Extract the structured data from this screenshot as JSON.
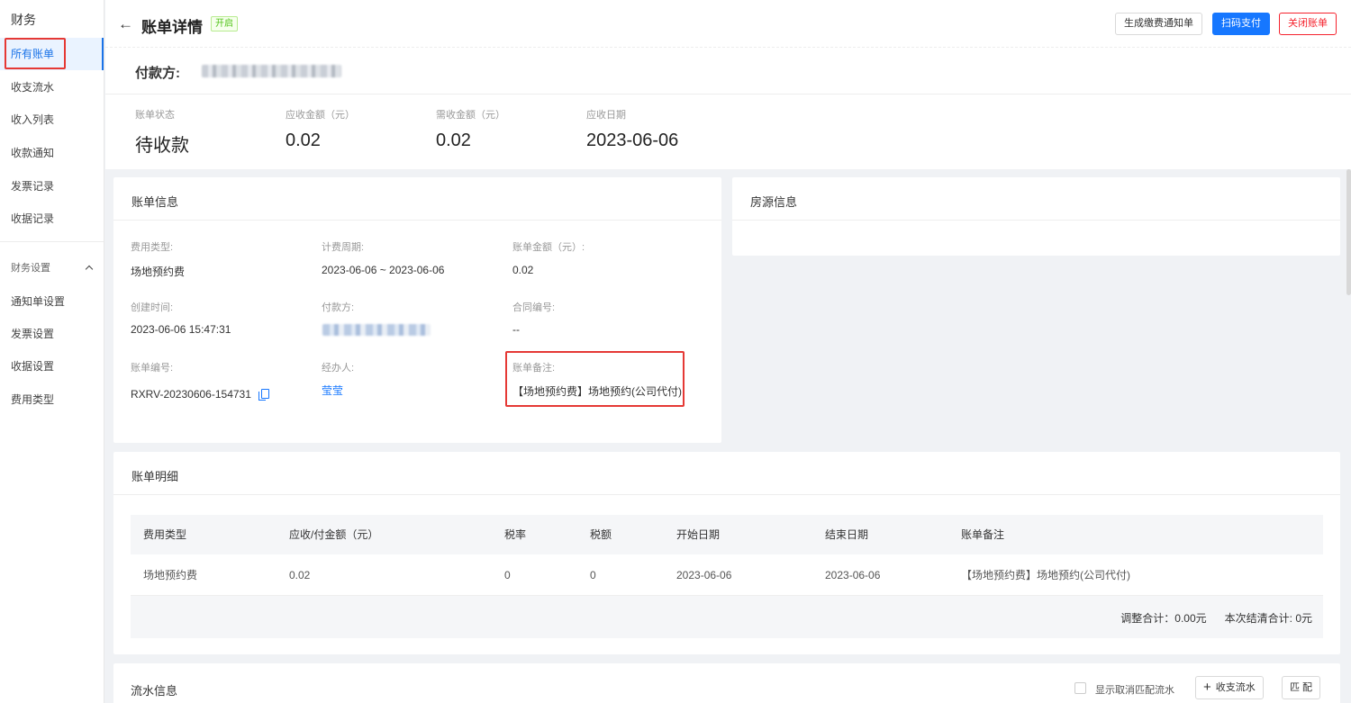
{
  "sidebar": {
    "title": "财务",
    "items": [
      {
        "label": "所有账单"
      },
      {
        "label": "收支流水"
      },
      {
        "label": "收入列表"
      },
      {
        "label": "收款通知"
      },
      {
        "label": "发票记录"
      },
      {
        "label": "收据记录"
      }
    ],
    "group_label": "财务设置",
    "sub_items": [
      {
        "label": "通知单设置"
      },
      {
        "label": "发票设置"
      },
      {
        "label": "收据设置"
      },
      {
        "label": "费用类型"
      }
    ]
  },
  "header": {
    "back_icon": "arrow-left",
    "title": "账单详情",
    "badge": "开启",
    "buttons": {
      "notice": "生成缴费通知单",
      "scan_pay": "扫码支付",
      "close_bill": "关闭账单"
    },
    "payer_label": "付款方:"
  },
  "summary": [
    {
      "label": "账单状态",
      "value": "待收款"
    },
    {
      "label": "应收金额（元）",
      "value": "0.02"
    },
    {
      "label": "需收金额（元）",
      "value": "0.02"
    },
    {
      "label": "应收日期",
      "value": "2023-06-06"
    }
  ],
  "bill_info": {
    "title": "账单信息",
    "fee_type": {
      "label": "费用类型:",
      "value": "场地预约费"
    },
    "period": {
      "label": "计费周期:",
      "value": "2023-06-06 ~ 2023-06-06"
    },
    "amount": {
      "label": "账单金额（元）:",
      "value": "0.02"
    },
    "created": {
      "label": "创建时间:",
      "value": "2023-06-06 15:47:31"
    },
    "payer": {
      "label": "付款方:"
    },
    "contract": {
      "label": "合同编号:",
      "value": "--"
    },
    "bill_no": {
      "label": "账单编号:",
      "value": "RXRV-20230606-154731"
    },
    "handler": {
      "label": "经办人:",
      "value": "莹莹"
    },
    "remark": {
      "label": "账单备注:",
      "value": "【场地预约费】场地预约(公司代付)"
    }
  },
  "house_info": {
    "title": "房源信息"
  },
  "detail": {
    "title": "账单明细",
    "columns": [
      "费用类型",
      "应收/付金额（元）",
      "税率",
      "税额",
      "开始日期",
      "结束日期",
      "账单备注"
    ],
    "rows": [
      [
        "场地预约费",
        "0.02",
        "0",
        "0",
        "2023-06-06",
        "2023-06-06",
        "【场地预约费】场地预约(公司代付)"
      ]
    ],
    "adjust_total": "调整合计：0.00元",
    "settle_total": "本次结清合计: 0元"
  },
  "flow": {
    "title": "流水信息",
    "checkbox_label": "显示取消匹配流水",
    "add_label": "收支流水",
    "match_label": "匹 配"
  },
  "colors": {
    "primary": "#1677ff",
    "danger": "#f5222d",
    "highlight": "#e53935",
    "success": "#52c41a"
  }
}
